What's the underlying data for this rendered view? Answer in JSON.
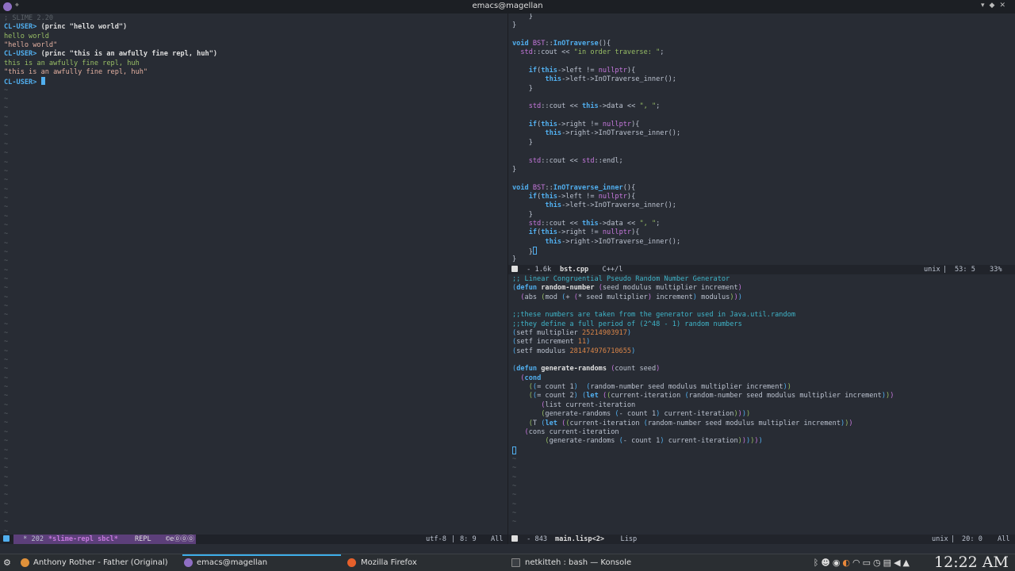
{
  "window": {
    "title": "emacs@magellan"
  },
  "left_repl": {
    "lines": [
      [
        {
          "c": "cmt",
          "t": "; SLIME 2.20"
        }
      ],
      [
        {
          "c": "prompt",
          "t": "CL-USER> "
        },
        {
          "c": "input",
          "t": "(princ \"hello world\")"
        }
      ],
      [
        {
          "c": "out",
          "t": "hello world"
        }
      ],
      [
        {
          "c": "str",
          "t": "\"hello world\""
        }
      ],
      [
        {
          "c": "prompt",
          "t": "CL-USER> "
        },
        {
          "c": "input",
          "t": "(princ \"this is an awfully fine repl, huh\")"
        }
      ],
      [
        {
          "c": "out",
          "t": "this is an awfully fine repl, huh"
        }
      ],
      [
        {
          "c": "str",
          "t": "\"this is an awfully fine repl, huh\""
        }
      ],
      [
        {
          "c": "prompt",
          "t": "CL-USER> "
        },
        {
          "c": "cursor",
          "t": ""
        }
      ]
    ],
    "tilde_count": 50
  },
  "cpp_buffer": {
    "lines": [
      [
        {
          "c": "plain",
          "t": "    }"
        }
      ],
      [
        {
          "c": "plain",
          "t": "}"
        }
      ],
      [
        {
          "c": "plain",
          "t": ""
        }
      ],
      [
        {
          "c": "kw",
          "t": "void "
        },
        {
          "c": "type",
          "t": "BST"
        },
        {
          "c": "plain",
          "t": "::"
        },
        {
          "c": "kw",
          "t": "InOTraverse"
        },
        {
          "c": "plain",
          "t": "(){"
        }
      ],
      [
        {
          "c": "plain",
          "t": "  "
        },
        {
          "c": "ns",
          "t": "std"
        },
        {
          "c": "plain",
          "t": "::cout << "
        },
        {
          "c": "cpp-str",
          "t": "\"in order traverse: \""
        },
        {
          "c": "plain",
          "t": ";"
        }
      ],
      [
        {
          "c": "plain",
          "t": ""
        }
      ],
      [
        {
          "c": "plain",
          "t": "    "
        },
        {
          "c": "kw",
          "t": "if"
        },
        {
          "c": "plain",
          "t": "("
        },
        {
          "c": "kw",
          "t": "this"
        },
        {
          "c": "plain",
          "t": "->left != "
        },
        {
          "c": "type",
          "t": "nullptr"
        },
        {
          "c": "plain",
          "t": "){"
        }
      ],
      [
        {
          "c": "plain",
          "t": "        "
        },
        {
          "c": "kw",
          "t": "this"
        },
        {
          "c": "plain",
          "t": "->left->InOTraverse_inner();"
        }
      ],
      [
        {
          "c": "plain",
          "t": "    }"
        }
      ],
      [
        {
          "c": "plain",
          "t": ""
        }
      ],
      [
        {
          "c": "plain",
          "t": "    "
        },
        {
          "c": "ns",
          "t": "std"
        },
        {
          "c": "plain",
          "t": "::cout << "
        },
        {
          "c": "kw",
          "t": "this"
        },
        {
          "c": "plain",
          "t": "->data << "
        },
        {
          "c": "cpp-str",
          "t": "\", \""
        },
        {
          "c": "plain",
          "t": ";"
        }
      ],
      [
        {
          "c": "plain",
          "t": ""
        }
      ],
      [
        {
          "c": "plain",
          "t": "    "
        },
        {
          "c": "kw",
          "t": "if"
        },
        {
          "c": "plain",
          "t": "("
        },
        {
          "c": "kw",
          "t": "this"
        },
        {
          "c": "plain",
          "t": "->right != "
        },
        {
          "c": "type",
          "t": "nullptr"
        },
        {
          "c": "plain",
          "t": "){"
        }
      ],
      [
        {
          "c": "plain",
          "t": "        "
        },
        {
          "c": "kw",
          "t": "this"
        },
        {
          "c": "plain",
          "t": "->right->InOTraverse_inner();"
        }
      ],
      [
        {
          "c": "plain",
          "t": "    }"
        }
      ],
      [
        {
          "c": "plain",
          "t": ""
        }
      ],
      [
        {
          "c": "plain",
          "t": "    "
        },
        {
          "c": "ns",
          "t": "std"
        },
        {
          "c": "plain",
          "t": "::cout << "
        },
        {
          "c": "ns",
          "t": "std"
        },
        {
          "c": "plain",
          "t": "::endl;"
        }
      ],
      [
        {
          "c": "plain",
          "t": "}"
        }
      ],
      [
        {
          "c": "plain",
          "t": ""
        }
      ],
      [
        {
          "c": "kw",
          "t": "void "
        },
        {
          "c": "type",
          "t": "BST"
        },
        {
          "c": "plain",
          "t": "::"
        },
        {
          "c": "kw",
          "t": "InOTraverse_inner"
        },
        {
          "c": "plain",
          "t": "(){"
        }
      ],
      [
        {
          "c": "plain",
          "t": "    "
        },
        {
          "c": "kw",
          "t": "if"
        },
        {
          "c": "plain",
          "t": "("
        },
        {
          "c": "kw",
          "t": "this"
        },
        {
          "c": "plain",
          "t": "->left != "
        },
        {
          "c": "type",
          "t": "nullptr"
        },
        {
          "c": "plain",
          "t": "){"
        }
      ],
      [
        {
          "c": "plain",
          "t": "        "
        },
        {
          "c": "kw",
          "t": "this"
        },
        {
          "c": "plain",
          "t": "->left->InOTraverse_inner();"
        }
      ],
      [
        {
          "c": "plain",
          "t": "    }"
        }
      ],
      [
        {
          "c": "plain",
          "t": "    "
        },
        {
          "c": "ns",
          "t": "std"
        },
        {
          "c": "plain",
          "t": "::cout << "
        },
        {
          "c": "kw",
          "t": "this"
        },
        {
          "c": "plain",
          "t": "->data << "
        },
        {
          "c": "cpp-str",
          "t": "\", \""
        },
        {
          "c": "plain",
          "t": ";"
        }
      ],
      [
        {
          "c": "plain",
          "t": "    "
        },
        {
          "c": "kw",
          "t": "if"
        },
        {
          "c": "plain",
          "t": "("
        },
        {
          "c": "kw",
          "t": "this"
        },
        {
          "c": "plain",
          "t": "->right != "
        },
        {
          "c": "type",
          "t": "nullptr"
        },
        {
          "c": "plain",
          "t": "){"
        }
      ],
      [
        {
          "c": "plain",
          "t": "        "
        },
        {
          "c": "kw",
          "t": "this"
        },
        {
          "c": "plain",
          "t": "->right->InOTraverse_inner();"
        }
      ],
      [
        {
          "c": "plain",
          "t": "    }"
        },
        {
          "c": "cursorbox",
          "t": ""
        }
      ],
      [
        {
          "c": "plain",
          "t": "}"
        }
      ]
    ]
  },
  "lisp_buffer": {
    "lines": [
      [
        {
          "c": "cmt2",
          "t": ";; Linear Congruential Pseudo Random Number Generator"
        }
      ],
      [
        {
          "c": "b1",
          "t": "("
        },
        {
          "c": "kw",
          "t": "defun "
        },
        {
          "c": "fn",
          "t": "random-number"
        },
        {
          "c": "plain",
          "t": " "
        },
        {
          "c": "b2",
          "t": "("
        },
        {
          "c": "plain",
          "t": "seed modulus multiplier increment"
        },
        {
          "c": "b2",
          "t": ")"
        }
      ],
      [
        {
          "c": "plain",
          "t": "  "
        },
        {
          "c": "b2",
          "t": "("
        },
        {
          "c": "plain",
          "t": "abs "
        },
        {
          "c": "b3",
          "t": "("
        },
        {
          "c": "plain",
          "t": "mod "
        },
        {
          "c": "b1",
          "t": "("
        },
        {
          "c": "plain",
          "t": "+ "
        },
        {
          "c": "b2",
          "t": "("
        },
        {
          "c": "plain",
          "t": "* seed multiplier"
        },
        {
          "c": "b2",
          "t": ")"
        },
        {
          "c": "plain",
          "t": " increment"
        },
        {
          "c": "b1",
          "t": ")"
        },
        {
          "c": "plain",
          "t": " modulus"
        },
        {
          "c": "b3",
          "t": ")"
        },
        {
          "c": "b2",
          "t": ")"
        },
        {
          "c": "b1",
          "t": ")"
        }
      ],
      [
        {
          "c": "plain",
          "t": ""
        }
      ],
      [
        {
          "c": "cmt2",
          "t": ";;these numbers are taken from the generator used in Java.util.random"
        }
      ],
      [
        {
          "c": "cmt2",
          "t": ";;they define a full period of (2^48 - 1) random numbers"
        }
      ],
      [
        {
          "c": "b1",
          "t": "("
        },
        {
          "c": "plain",
          "t": "setf multiplier "
        },
        {
          "c": "num",
          "t": "25214903917"
        },
        {
          "c": "b1",
          "t": ")"
        }
      ],
      [
        {
          "c": "b1",
          "t": "("
        },
        {
          "c": "plain",
          "t": "setf increment "
        },
        {
          "c": "num",
          "t": "11"
        },
        {
          "c": "b1",
          "t": ")"
        }
      ],
      [
        {
          "c": "b1",
          "t": "("
        },
        {
          "c": "plain",
          "t": "setf modulus "
        },
        {
          "c": "num",
          "t": "281474976710655"
        },
        {
          "c": "b1",
          "t": ")"
        }
      ],
      [
        {
          "c": "plain",
          "t": ""
        }
      ],
      [
        {
          "c": "b1",
          "t": "("
        },
        {
          "c": "kw",
          "t": "defun "
        },
        {
          "c": "fn",
          "t": "generate-randoms"
        },
        {
          "c": "plain",
          "t": " "
        },
        {
          "c": "b2",
          "t": "("
        },
        {
          "c": "plain",
          "t": "count seed"
        },
        {
          "c": "b2",
          "t": ")"
        }
      ],
      [
        {
          "c": "plain",
          "t": "  "
        },
        {
          "c": "b2",
          "t": "("
        },
        {
          "c": "kw",
          "t": "cond"
        }
      ],
      [
        {
          "c": "plain",
          "t": "    "
        },
        {
          "c": "b3",
          "t": "("
        },
        {
          "c": "b1",
          "t": "("
        },
        {
          "c": "plain",
          "t": "= count 1"
        },
        {
          "c": "b1",
          "t": ")"
        },
        {
          "c": "plain",
          "t": "  "
        },
        {
          "c": "b1",
          "t": "("
        },
        {
          "c": "plain",
          "t": "random-number seed modulus multiplier increment"
        },
        {
          "c": "b1",
          "t": ")"
        },
        {
          "c": "b3",
          "t": ")"
        }
      ],
      [
        {
          "c": "plain",
          "t": "    "
        },
        {
          "c": "b3",
          "t": "("
        },
        {
          "c": "b1",
          "t": "("
        },
        {
          "c": "plain",
          "t": "= count 2"
        },
        {
          "c": "b1",
          "t": ")"
        },
        {
          "c": "plain",
          "t": " "
        },
        {
          "c": "b1",
          "t": "("
        },
        {
          "c": "kw",
          "t": "let"
        },
        {
          "c": "plain",
          "t": " "
        },
        {
          "c": "b2",
          "t": "("
        },
        {
          "c": "b3",
          "t": "("
        },
        {
          "c": "plain",
          "t": "current-iteration "
        },
        {
          "c": "b1",
          "t": "("
        },
        {
          "c": "plain",
          "t": "random-number seed modulus multiplier increment"
        },
        {
          "c": "b1",
          "t": ")"
        },
        {
          "c": "b3",
          "t": ")"
        },
        {
          "c": "b2",
          "t": ")"
        }
      ],
      [
        {
          "c": "plain",
          "t": "       "
        },
        {
          "c": "b2",
          "t": "("
        },
        {
          "c": "plain",
          "t": "list current-iteration"
        }
      ],
      [
        {
          "c": "plain",
          "t": "       "
        },
        {
          "c": "b3",
          "t": "("
        },
        {
          "c": "plain",
          "t": "generate-randoms "
        },
        {
          "c": "b1",
          "t": "("
        },
        {
          "c": "plain",
          "t": "- count 1"
        },
        {
          "c": "b1",
          "t": ")"
        },
        {
          "c": "plain",
          "t": " current-iteration"
        },
        {
          "c": "b3",
          "t": ")"
        },
        {
          "c": "b2",
          "t": ")"
        },
        {
          "c": "b1",
          "t": ")"
        },
        {
          "c": "b3",
          "t": ")"
        }
      ],
      [
        {
          "c": "plain",
          "t": "    "
        },
        {
          "c": "b3",
          "t": "("
        },
        {
          "c": "plain",
          "t": "T "
        },
        {
          "c": "b1",
          "t": "("
        },
        {
          "c": "kw",
          "t": "let"
        },
        {
          "c": "plain",
          "t": " "
        },
        {
          "c": "b2",
          "t": "("
        },
        {
          "c": "b3",
          "t": "("
        },
        {
          "c": "plain",
          "t": "current-iteration "
        },
        {
          "c": "b1",
          "t": "("
        },
        {
          "c": "plain",
          "t": "random-number seed modulus multiplier increment"
        },
        {
          "c": "b1",
          "t": ")"
        },
        {
          "c": "b3",
          "t": ")"
        },
        {
          "c": "b2",
          "t": ")"
        }
      ],
      [
        {
          "c": "plain",
          "t": "   "
        },
        {
          "c": "b2",
          "t": "("
        },
        {
          "c": "plain",
          "t": "cons current-iteration"
        }
      ],
      [
        {
          "c": "plain",
          "t": "        "
        },
        {
          "c": "b3",
          "t": "("
        },
        {
          "c": "plain",
          "t": "generate-randoms "
        },
        {
          "c": "b1",
          "t": "("
        },
        {
          "c": "plain",
          "t": "- count 1"
        },
        {
          "c": "b1",
          "t": ")"
        },
        {
          "c": "plain",
          "t": " current-iteration"
        },
        {
          "c": "b3",
          "t": ")"
        },
        {
          "c": "b2",
          "t": ")"
        },
        {
          "c": "b1",
          "t": ")"
        },
        {
          "c": "b3",
          "t": ")"
        },
        {
          "c": "b2",
          "t": ")"
        },
        {
          "c": "b1",
          "t": ")"
        }
      ],
      [
        {
          "c": "cursorbox",
          "t": ""
        }
      ]
    ],
    "tilde_count": 8
  },
  "modelines": {
    "right_top": {
      "left": " - 1.6k ",
      "buffer": "bst.cpp",
      "mode": "   C++/l",
      "encoding": "unix",
      "position": "53: 5",
      "percent": "33%"
    },
    "left": {
      "left": " * 202 ",
      "buffer": "*slime-repl sbcl*",
      "mode": "REPL",
      "extra": "©e⓪⓪⓪",
      "encoding": "utf-8",
      "position": "8: 9",
      "percent": "All"
    },
    "right_bottom": {
      "left": " - 843 ",
      "buffer": "main.lisp<2>",
      "mode": "   Lisp",
      "encoding": "unix",
      "position": "20: 0",
      "percent": "All"
    }
  },
  "taskbar": {
    "tasks": [
      {
        "label": "Anthony Rother - Father (Original)",
        "icon": "music-player-icon",
        "color": "#e0913a"
      },
      {
        "label": "emacs@magellan",
        "icon": "emacs-icon",
        "color": "#8f6fc4"
      },
      {
        "label": "Mozilla Firefox",
        "icon": "firefox-icon",
        "color": "#e6602b"
      },
      {
        "label": "netkitteh : bash — Konsole",
        "icon": "terminal-icon",
        "color": "#3b3f44"
      }
    ],
    "tray_icons": [
      "bluetooth-icon",
      "discord-icon",
      "steam-icon",
      "redshift-icon",
      "wifi-icon",
      "battery-icon",
      "updates-icon",
      "clipboard-icon",
      "volume-icon",
      "expand-tray-icon"
    ],
    "clock": "12:22 AM"
  }
}
